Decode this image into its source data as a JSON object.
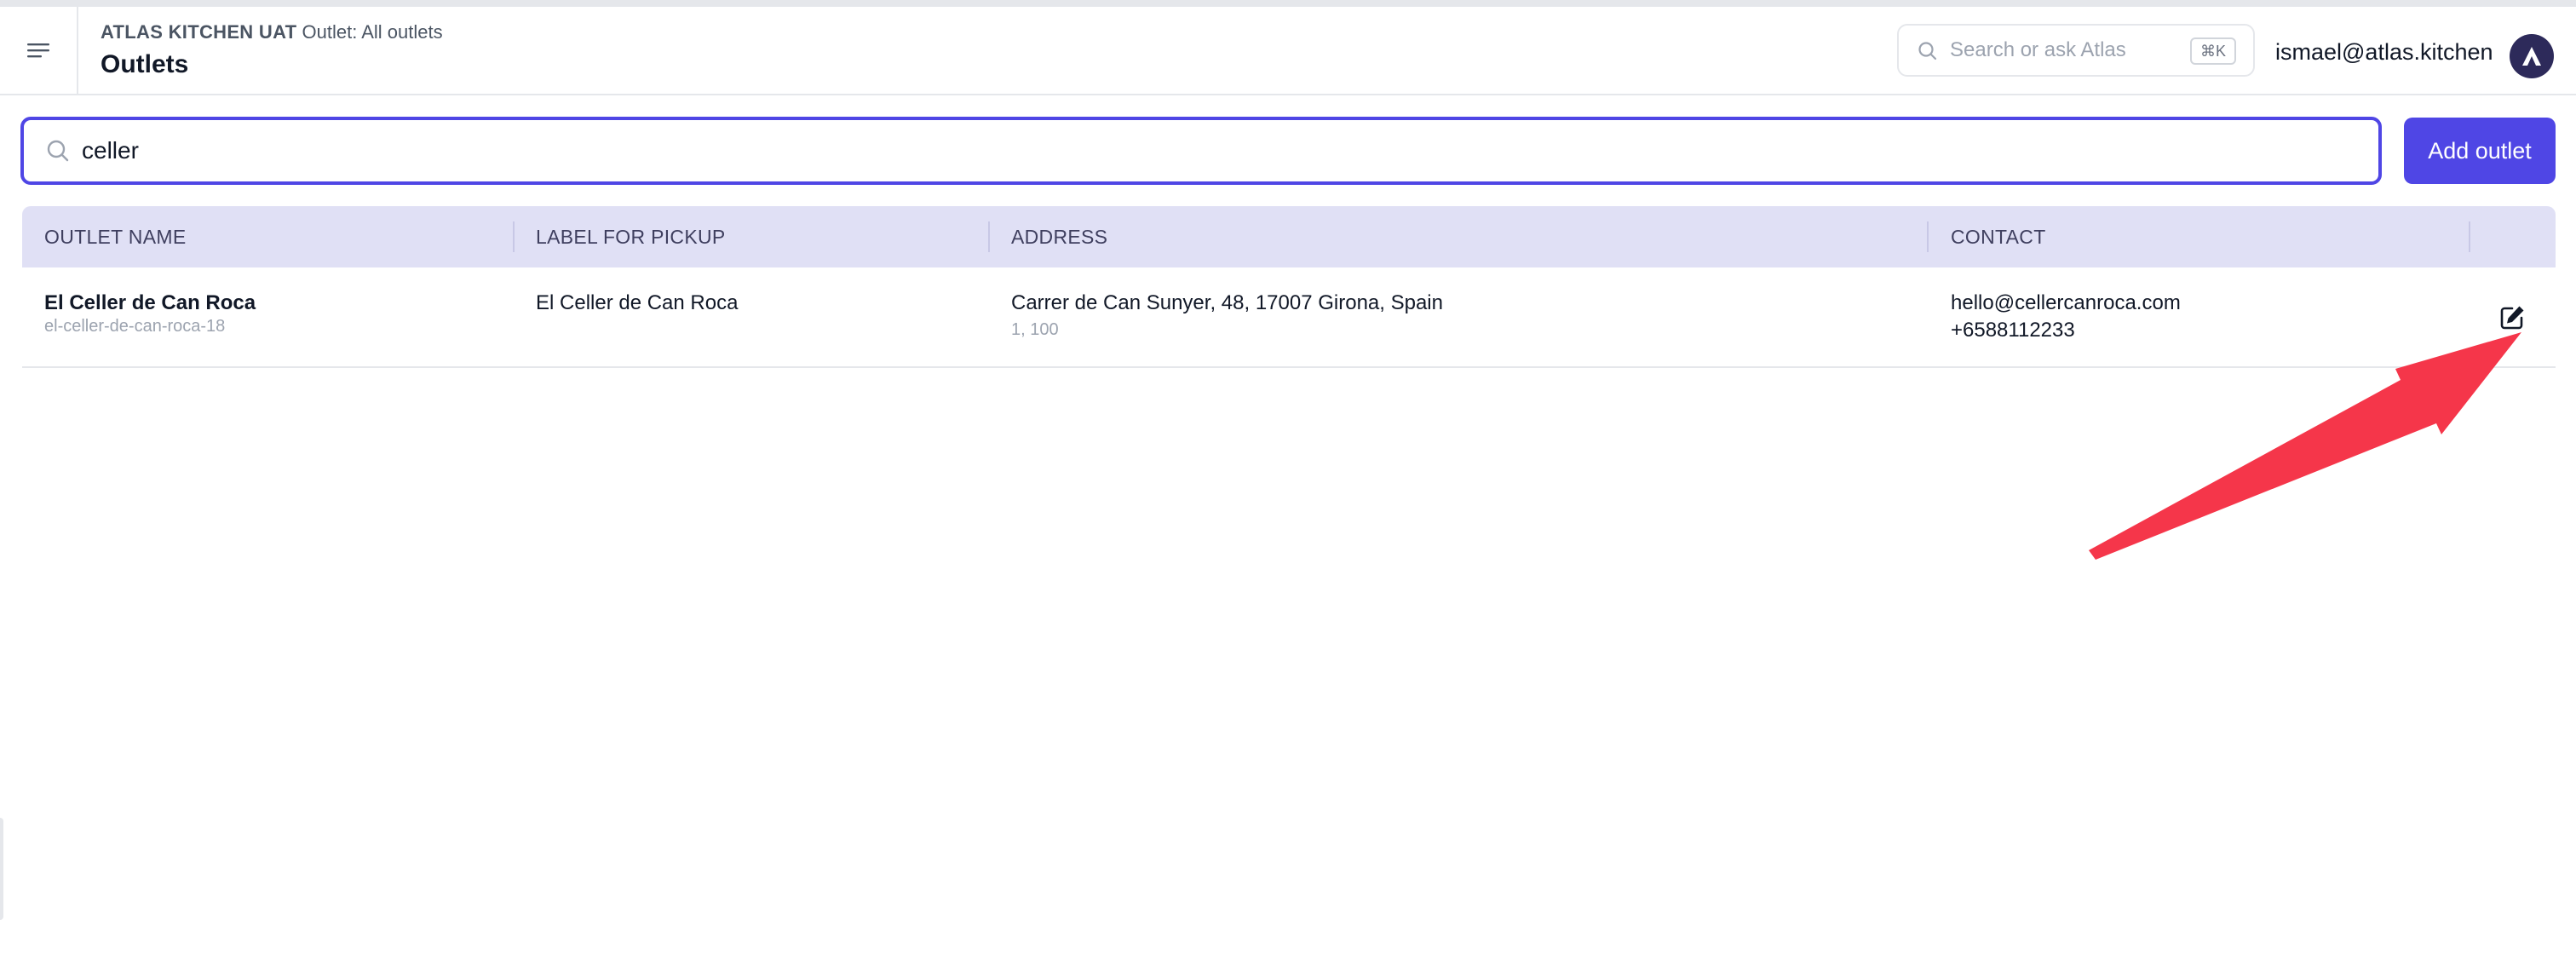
{
  "header": {
    "org": "ATLAS KITCHEN UAT",
    "outlet_context": "Outlet: All outlets",
    "title": "Outlets",
    "search_placeholder": "Search or ask Atlas",
    "search_shortcut": "⌘K",
    "user_email": "ismael@atlas.kitchen"
  },
  "search": {
    "value": "celler"
  },
  "add_outlet_label": "Add outlet",
  "table": {
    "columns": [
      "OUTLET NAME",
      "LABEL FOR PICKUP",
      "ADDRESS",
      "CONTACT"
    ],
    "rows": [
      {
        "name": "El Celler de Can Roca",
        "slug": "el-celler-de-can-roca-18",
        "pickup_label": "El Celler de Can Roca",
        "address": "Carrer de Can Sunyer, 48, 17007 Girona, Spain",
        "address_coords": "1, 100",
        "email": "hello@cellercanroca.com",
        "phone": "+6588112233"
      }
    ]
  },
  "icons": {
    "menu": "hamburger-menu-icon",
    "search": "search-icon",
    "avatar": "atlas-logo-icon",
    "edit": "edit-icon"
  },
  "colors": {
    "accent": "#4f46e5",
    "table_header_bg": "#e0e0f5",
    "annotation_arrow": "#f5364a"
  }
}
